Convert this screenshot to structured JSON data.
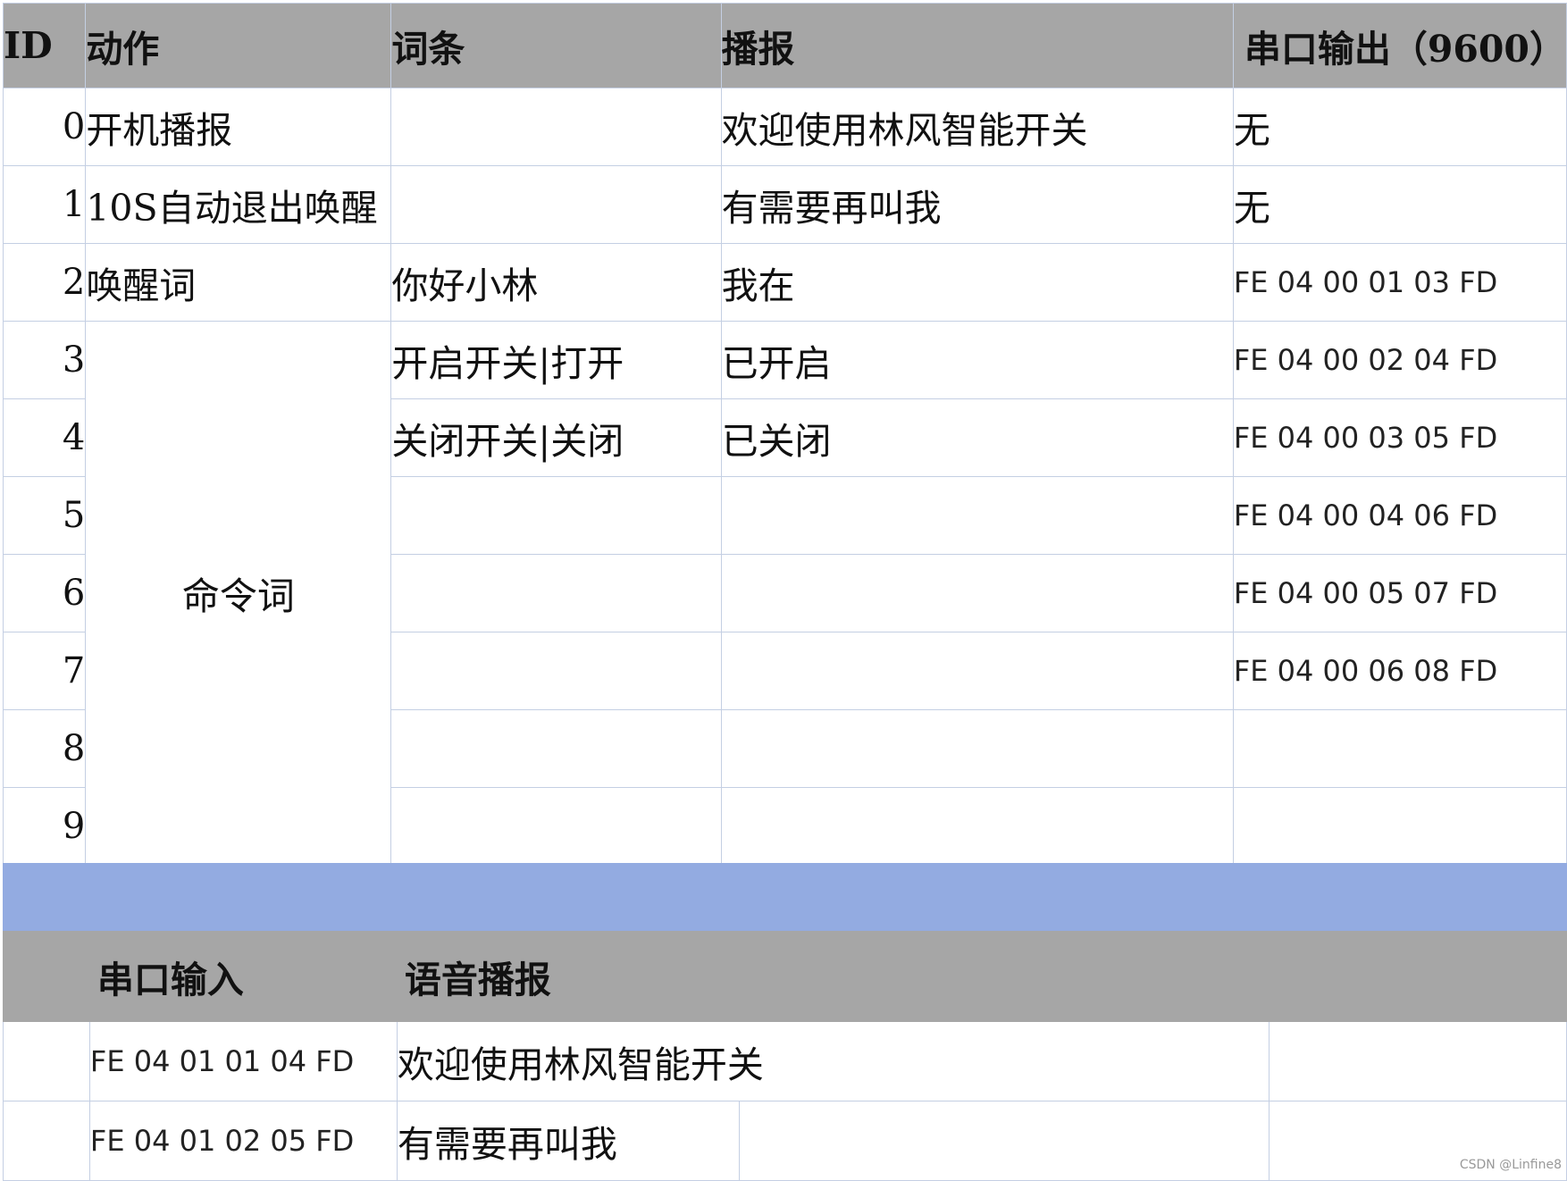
{
  "main_table": {
    "headers": [
      "ID",
      "动作",
      "词条",
      "播报",
      "串口输出（9600）"
    ],
    "rows": [
      {
        "id": "0",
        "action": "开机播报",
        "entry": "",
        "broadcast": "欢迎使用林风智能开关",
        "serial": "无"
      },
      {
        "id": "1",
        "action": "10S自动退出唤醒",
        "entry": "",
        "broadcast": "有需要再叫我",
        "serial": "无"
      },
      {
        "id": "2",
        "action": "唤醒词",
        "entry": "你好小林",
        "broadcast": "我在",
        "serial": "FE 04 00 01 03 FD"
      },
      {
        "id": "3",
        "action": "命令词",
        "entry": "开启开关|打开",
        "broadcast": "已开启",
        "serial": "FE 04 00 02 04 FD"
      },
      {
        "id": "4",
        "action": "",
        "entry": "关闭开关|关闭",
        "broadcast": "已关闭",
        "serial": "FE 04 00 03 05 FD"
      },
      {
        "id": "5",
        "action": "",
        "entry": "",
        "broadcast": "",
        "serial": "FE 04 00 04 06 FD"
      },
      {
        "id": "6",
        "action": "",
        "entry": "",
        "broadcast": "",
        "serial": "FE 04 00 05 07 FD"
      },
      {
        "id": "7",
        "action": "",
        "entry": "",
        "broadcast": "",
        "serial": "FE 04 00 06 08 FD"
      },
      {
        "id": "8",
        "action": "",
        "entry": "",
        "broadcast": "",
        "serial": ""
      },
      {
        "id": "9",
        "action": "",
        "entry": "",
        "broadcast": "",
        "serial": ""
      }
    ]
  },
  "serial_table": {
    "headers": [
      "串口输入",
      "语音播报"
    ],
    "rows": [
      {
        "input": "FE 04 01 01 04 FD",
        "voice": "欢迎使用林风智能开关"
      },
      {
        "input": "FE 04 01 02 05 FD",
        "voice": "有需要再叫我"
      }
    ]
  },
  "watermark": "CSDN @Linfine8",
  "colors": {
    "header_bg": "#a6a6a6",
    "band": "#93abe1",
    "grid_line": "#c4cfe3"
  }
}
